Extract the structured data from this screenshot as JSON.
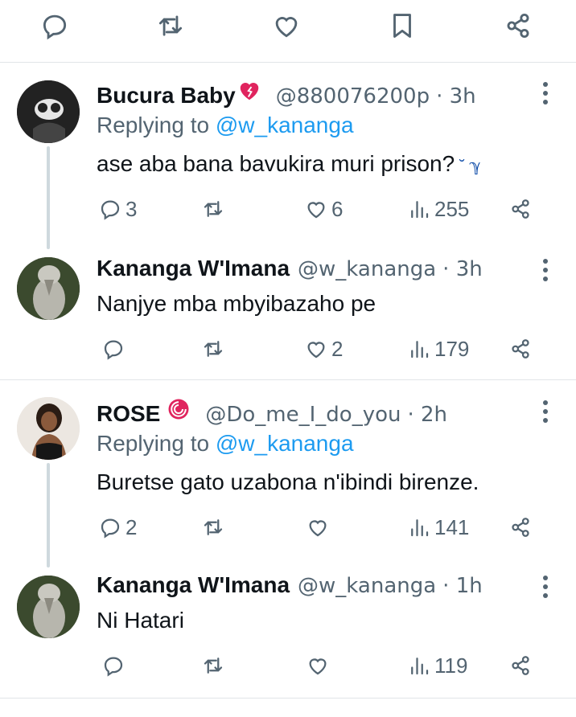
{
  "top_actions": [
    "reply",
    "retweet",
    "like",
    "bookmark",
    "share"
  ],
  "colors": {
    "accent": "#1d9bf0",
    "muted": "#536471",
    "text": "#0f1419",
    "rose": "#e0245e"
  },
  "tweets": [
    {
      "name": "Bucura Baby",
      "emoji": "heart-emoji",
      "handle": "@880076200p",
      "time": "· 3h",
      "replying_prefix": "Replying to ",
      "replying_to": "@w_kananga",
      "text": "ase aba bana bavukira muri prison?",
      "text_symbol": "˘ ℽ",
      "replies": "3",
      "retweets": "",
      "likes": "6",
      "views": "255"
    },
    {
      "name": "Kananga W'Imana",
      "handle": "@w_kananga",
      "time": "· 3h",
      "text": "Nanjye mba mbyibazaho pe",
      "replies": "",
      "retweets": "",
      "likes": "2",
      "views": "179"
    },
    {
      "name": "ROSE",
      "emoji": "rose-emoji",
      "handle": "@Do_me_I_do_you",
      "time": "· 2h",
      "replying_prefix": "Replying to ",
      "replying_to": "@w_kananga",
      "text": "Buretse gato uzabona n'ibindi birenze.",
      "replies": "2",
      "retweets": "",
      "likes": "",
      "views": "141"
    },
    {
      "name": "Kananga W'Imana",
      "handle": "@w_kananga",
      "time": "· 1h",
      "text": "Ni Hatari",
      "replies": "",
      "retweets": "",
      "likes": "",
      "views": "119"
    }
  ]
}
